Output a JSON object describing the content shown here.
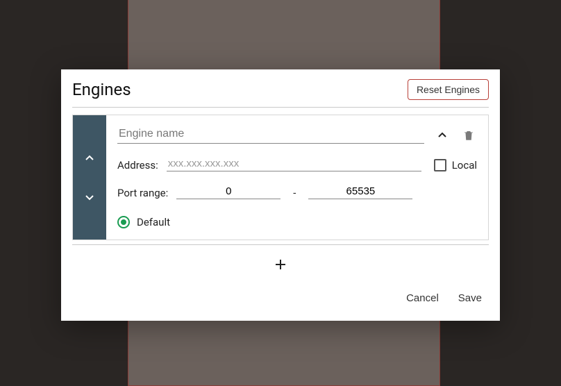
{
  "dialog": {
    "title": "Engines",
    "reset_label": "Reset Engines",
    "engine": {
      "name_placeholder": "Engine name",
      "name_value": "",
      "address_label": "Address:",
      "address_placeholder": "xxx.xxx.xxx.xxx",
      "address_value": "",
      "local_label": "Local",
      "local_checked": false,
      "port_range_label": "Port range:",
      "port_from": "0",
      "port_to": "65535",
      "default_label": "Default",
      "default_checked": true
    },
    "actions": {
      "cancel": "Cancel",
      "save": "Save"
    },
    "port_separator": "-"
  }
}
